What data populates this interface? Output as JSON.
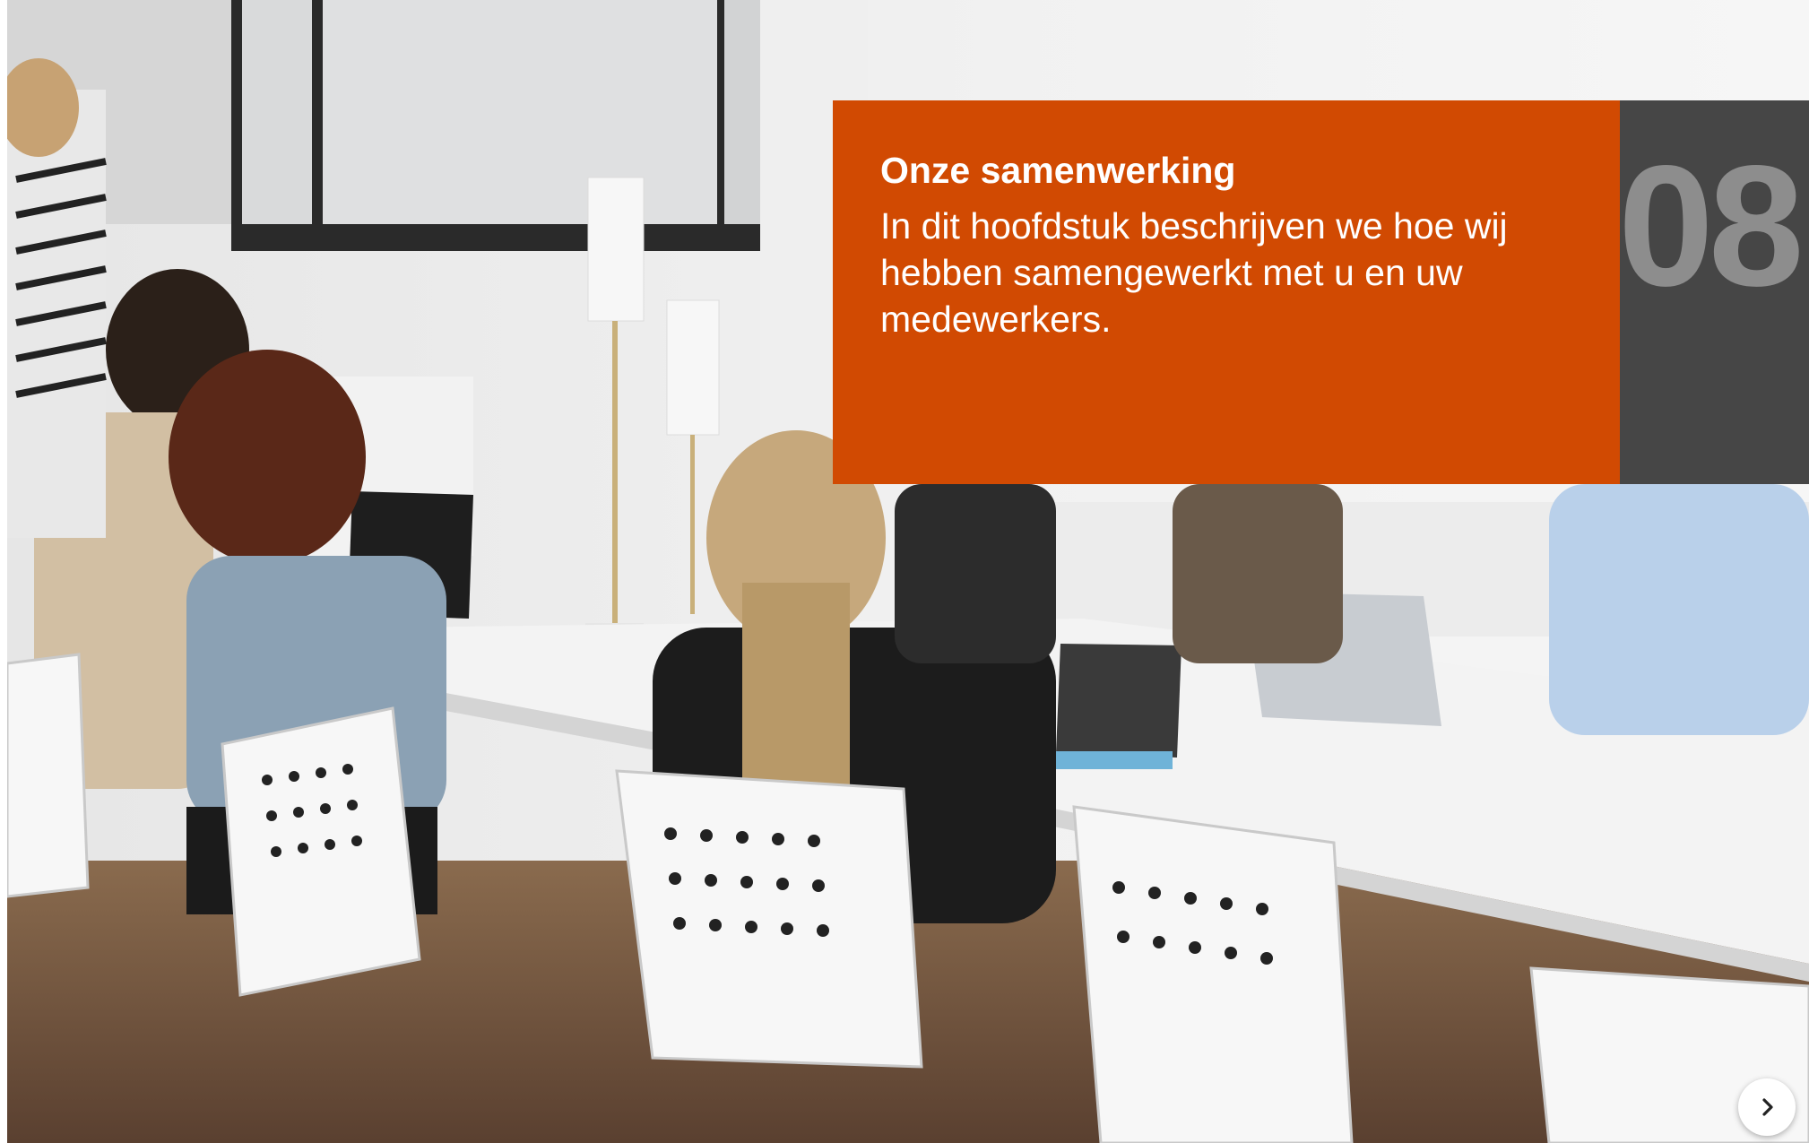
{
  "slide": {
    "title": "Onze samenwerking",
    "subtitle": "In dit hoofdstuk beschrijven we hoe wij hebben samengewerkt met u en uw medewerkers.",
    "chapter_number": "08"
  },
  "photo": {
    "description_icon": "office-meeting-photo"
  },
  "navigation": {
    "next_icon": "chevron-right-icon"
  },
  "colors": {
    "accent": "#d14a02",
    "number_panel": "#464646",
    "number_text": "#8d8d8d"
  }
}
